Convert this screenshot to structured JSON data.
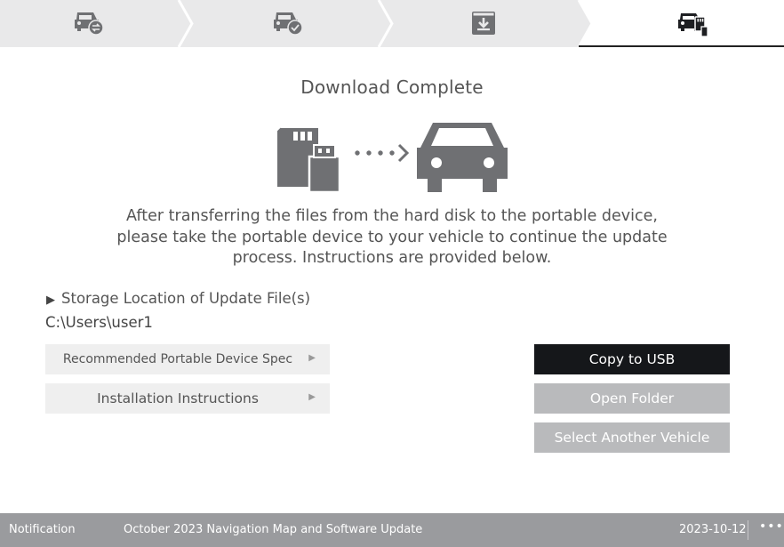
{
  "steps": [
    {
      "icon": "car-swap-icon",
      "state": "done"
    },
    {
      "icon": "car-check-icon",
      "state": "done"
    },
    {
      "icon": "download-box-icon",
      "state": "done"
    },
    {
      "icon": "car-device-icon",
      "state": "active"
    }
  ],
  "main": {
    "title": "Download Complete",
    "hero_icons": [
      "portable-device-icon",
      "transfer-arrow-icon",
      "car-icon"
    ],
    "description": [
      "After transferring the files from the hard disk to the portable device,",
      "please take the portable device to your vehicle to continue the update",
      "process. Instructions are provided below."
    ],
    "storage_label": "Storage Location of Update File(s)",
    "storage_path": "C:\\Users\\user1",
    "links": {
      "device_spec": "Recommended Portable Device Spec",
      "install_instructions": "Installation Instructions"
    },
    "actions": {
      "copy_usb": "Copy to USB",
      "open_folder": "Open Folder",
      "select_vehicle": "Select Another Vehicle"
    }
  },
  "footer": {
    "notification": "Notification",
    "message": "October 2023 Navigation Map and Software Update",
    "date": "2023-10-12",
    "more": "•••"
  },
  "colors": {
    "step_bg": "#e9e9ea",
    "step_active_bg": "#ffffff",
    "icon_gray": "#6f7073",
    "primary_button": "#15171a",
    "secondary_button": "#b9babc",
    "footer_bg": "#9a9b9e"
  }
}
